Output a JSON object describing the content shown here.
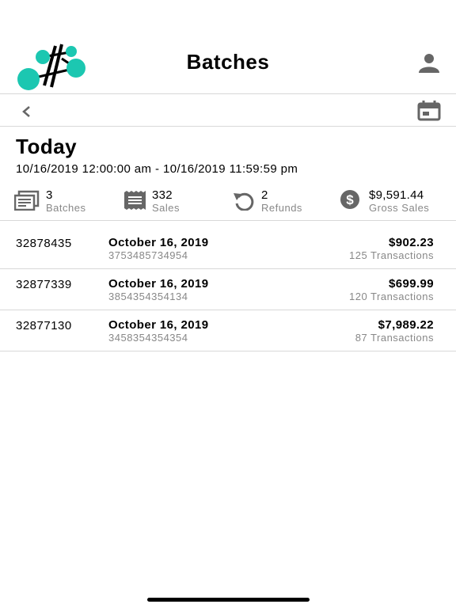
{
  "header": {
    "title": "Batches"
  },
  "icons": {
    "logo": "logo-icon",
    "user": "user-icon",
    "back": "chevron-left-icon",
    "calendar": "calendar-icon",
    "batches": "batches-icon",
    "sales": "receipt-icon",
    "refunds": "refund-icon",
    "gross": "dollar-icon"
  },
  "toolbar": {
    "back_label": "<"
  },
  "range": {
    "title": "Today",
    "dates": "10/16/2019 12:00:00 am - 10/16/2019 11:59:59 pm"
  },
  "stats": [
    {
      "value": "3",
      "label": "Batches"
    },
    {
      "value": "332",
      "label": "Sales"
    },
    {
      "value": "2",
      "label": "Refunds"
    },
    {
      "value": "$9,591.44",
      "label": "Gross Sales"
    }
  ],
  "batches": [
    {
      "id": "32878435",
      "date": "October 16, 2019",
      "ref": "3753485734954",
      "amount": "$902.23",
      "transactions": "125 Transactions"
    },
    {
      "id": "32877339",
      "date": "October 16, 2019",
      "ref": "3854354354134",
      "amount": "$699.99",
      "transactions": "120 Transactions"
    },
    {
      "id": "32877130",
      "date": "October 16, 2019",
      "ref": "3458354354354",
      "amount": "$7,989.22",
      "transactions": "87 Transactions"
    }
  ],
  "colors": {
    "logo_teal": "#1cc7b1",
    "icon_gray": "#666666",
    "label_gray": "#888888",
    "divider": "#d8d8d8"
  }
}
